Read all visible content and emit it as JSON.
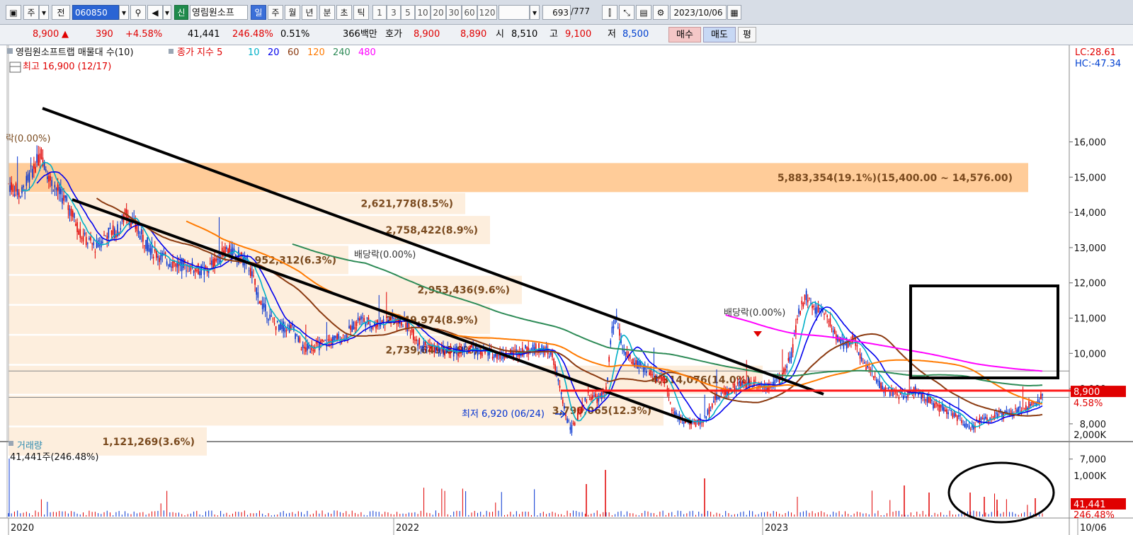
{
  "toolbar": {
    "unit": "주",
    "prev": "전",
    "code": "060850",
    "stock_tag": "신",
    "stock_name": "영림원소프",
    "periods": [
      "일",
      "주",
      "월",
      "년",
      "분",
      "초",
      "틱"
    ],
    "numbers": [
      "1",
      "3",
      "5",
      "10",
      "20",
      "30",
      "60",
      "120"
    ],
    "count": "693",
    "total": "/777",
    "date": "2023/10/06"
  },
  "info": {
    "price": "8,900",
    "change": "390",
    "change_pct": "+4.58%",
    "volume": "41,441",
    "vol_ratio": "246.48%",
    "turnover": "0.51%",
    "amount": "366백만",
    "bid_label": "호가",
    "ask": "8,900",
    "bid": "8,890",
    "open_label": "시",
    "open": "8,510",
    "high_label": "고",
    "high": "9,100",
    "low_label": "저",
    "low": "8,500",
    "buy": "매수",
    "sell": "매도",
    "avg": "평"
  },
  "chart": {
    "title": "영림원소프트랩 매물대 수(10)",
    "ma_label": "종가 지수 5",
    "ma_periods": [
      "10",
      "20",
      "60",
      "120",
      "240",
      "480"
    ],
    "ma_colors": [
      "#00b0c8",
      "#0000ee",
      "#8b3a10",
      "#ff7a00",
      "#2e8b57",
      "#ff00ff"
    ],
    "high_note": "최고 16,900 (12/17)",
    "low_note": "최저 6,920 (06/24)",
    "dividend_notes": [
      "배당락(0.00%)",
      "배당락(0.00%)"
    ],
    "left_note": "락(0.00%)",
    "lc": "LC:28.61",
    "hc": "HC:-47.34",
    "price_tag": "8,900",
    "pct_tag": "4.58%",
    "y_labels": [
      "16,000",
      "15,000",
      "14,000",
      "13,000",
      "12,000",
      "11,000",
      "10,000",
      "9,000",
      "8,000",
      "7,000"
    ],
    "x_labels": [
      "2020",
      "2022",
      "2023",
      "10/06"
    ],
    "profile": [
      {
        "text": "5,883,354(19.1%)(15,400.00 ~ 14,576.00)"
      },
      {
        "text": "2,621,778(8.5%)"
      },
      {
        "text": "2,758,422(8.9%)"
      },
      {
        "text": "952,312(6.3%)"
      },
      {
        "text": "2,953,436(9.6%)"
      },
      {
        "text": "2,749,974(8.9%)"
      },
      {
        "text": "2,739,649(8.9%)"
      },
      {
        "text": "4,314,076(14.0%)"
      },
      {
        "text": "3,790,065(12.3%)"
      },
      {
        "text": "1,121,269(3.6%)"
      }
    ]
  },
  "volume": {
    "title": "거래량",
    "current": "41,441주(246.48%)",
    "y_labels": [
      "2,000K",
      "1,000K"
    ],
    "vol_tag": "41,441",
    "vol_pct_tag": "246.48%"
  }
}
